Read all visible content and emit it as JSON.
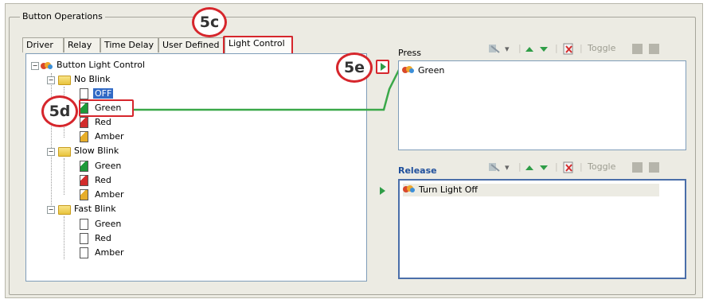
{
  "window": {
    "group_title": "Button Operations"
  },
  "tabs": [
    "Driver",
    "Relay",
    "Time Delay",
    "User Defined",
    "Light Control"
  ],
  "active_tab": "Light Control",
  "tree": {
    "root": "Button Light Control",
    "groups": [
      {
        "label": "No Blink",
        "items": [
          "OFF",
          "Green",
          "Red",
          "Amber"
        ]
      },
      {
        "label": "Slow Blink",
        "items": [
          "Green",
          "Red",
          "Amber"
        ]
      },
      {
        "label": "Fast Blink",
        "items": [
          "Green",
          "Red",
          "Amber"
        ]
      }
    ],
    "selected": "OFF"
  },
  "press": {
    "label": "Press",
    "items": [
      "Green"
    ],
    "toggle_label": "Toggle"
  },
  "release": {
    "label": "Release",
    "items": [
      "Turn Light Off"
    ],
    "toggle_label": "Toggle"
  },
  "callouts": {
    "tab": "5c",
    "tree_item": "5d",
    "add_arrow": "5e"
  },
  "colors": {
    "callout_red": "#d6262c",
    "connector_green": "#3aa849",
    "selection_blue": "#316ac5"
  }
}
